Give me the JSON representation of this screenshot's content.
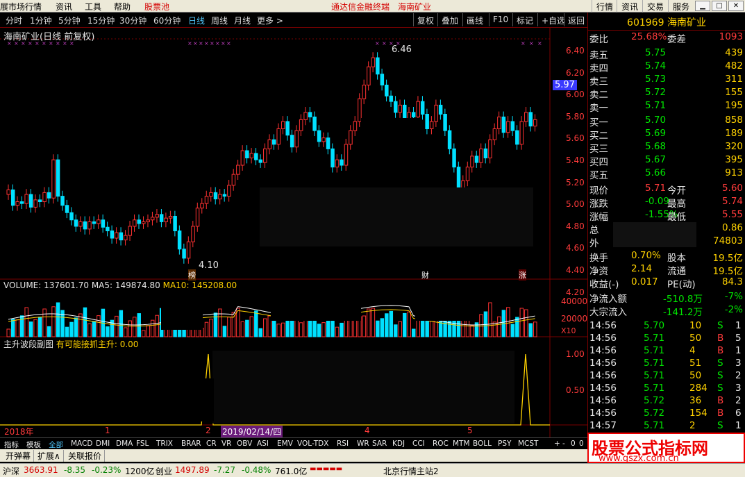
{
  "menubar": {
    "items": [
      "展市场行情",
      "资讯",
      "工具",
      "帮助",
      "股票池"
    ],
    "center": [
      "通达信金融终端",
      "海南矿业"
    ],
    "right": [
      "行情",
      "资讯",
      "交易",
      "服务"
    ]
  },
  "toolbar": {
    "periods": [
      "分时",
      "1分钟",
      "5分钟",
      "15分钟",
      "30分钟",
      "60分钟",
      "日线",
      "周线",
      "月线",
      "更多 >"
    ],
    "active": "日线",
    "buttons": [
      "复权",
      "叠加",
      "画线",
      "F10",
      "标记",
      "+自选",
      "返回"
    ]
  },
  "chart": {
    "title": "海南矿业(日线 前复权)",
    "price_tag": "5.97",
    "high_label": "6.46",
    "low_label": "4.10",
    "markers": [
      "榜",
      "财",
      "涨"
    ],
    "y_ticks": [
      "6.40",
      "6.20",
      "6.00",
      "5.80",
      "5.60",
      "5.40",
      "5.20",
      "5.00",
      "4.80",
      "4.60",
      "4.40",
      "4.20"
    ],
    "volume_header": {
      "vol": "VOLUME: 137601.70",
      "ma5": "MA5: 149874.80",
      "ma10": "MA10: 145208.00"
    },
    "vol_ticks": [
      "40000",
      "20000",
      "X10"
    ],
    "ind_header": {
      "name": "主升波段副图",
      "text": "有可能接抓主升: 0.00"
    },
    "ind_ticks": [
      "1.00",
      "0.50"
    ],
    "date_axis": {
      "year": "2018年",
      "labels": [
        "1",
        "2",
        "4",
        "5"
      ],
      "cursor_date": "2019/02/14/四"
    }
  },
  "chart_data": {
    "type": "candlestick",
    "high": 6.46,
    "low": 4.1,
    "last": 5.97,
    "vol": 137601.7,
    "ma5": 149874.8,
    "ma10": 145208.0,
    "ylim": [
      4.1,
      6.5
    ],
    "closes": [
      4.95,
      4.78,
      4.82,
      4.8,
      4.9,
      4.76,
      4.84,
      4.82,
      4.92,
      4.86,
      5.28,
      4.88,
      4.78,
      4.7,
      4.62,
      4.55,
      4.6,
      4.52,
      4.6,
      4.58,
      4.62,
      4.54,
      4.5,
      4.42,
      4.48,
      4.4,
      4.45,
      4.55,
      4.62,
      4.58,
      4.6,
      4.62,
      4.65,
      4.68,
      4.6,
      4.64,
      4.66,
      4.5,
      4.3,
      4.2,
      4.38,
      4.55,
      4.75,
      4.8,
      4.88,
      4.92,
      4.85,
      4.9,
      4.88,
      5.0,
      5.12,
      5.22,
      5.38,
      5.3,
      5.35,
      5.28,
      5.25,
      5.4,
      5.5,
      5.45,
      5.62,
      5.7,
      5.55,
      5.42,
      5.6,
      5.72,
      5.8,
      5.75,
      5.6,
      5.48,
      5.52,
      5.4,
      5.2,
      5.28,
      5.22,
      5.45,
      5.6,
      5.7,
      5.95,
      6.1,
      6.3,
      6.4,
      6.22,
      6.1,
      5.98,
      5.92,
      5.8,
      5.88,
      5.72,
      5.8,
      5.75,
      5.92,
      5.78,
      5.62,
      5.7,
      5.88,
      5.78,
      5.6,
      5.4,
      5.2,
      4.9,
      5.05,
      5.2,
      5.32,
      5.25,
      5.4,
      5.3,
      5.5,
      5.62,
      5.75,
      5.58,
      5.7,
      5.6,
      5.45,
      5.7,
      5.8,
      5.65,
      5.72
    ]
  },
  "book": {
    "code": "601969",
    "name": "海南矿业",
    "weibi": {
      "l": "委比",
      "v": "25.68%",
      "l2": "委差",
      "v2": "1093"
    },
    "sell": [
      {
        "l": "卖五",
        "p": "5.75",
        "q": "439"
      },
      {
        "l": "卖四",
        "p": "5.74",
        "q": "482"
      },
      {
        "l": "卖三",
        "p": "5.73",
        "q": "311"
      },
      {
        "l": "卖二",
        "p": "5.72",
        "q": "155"
      },
      {
        "l": "卖一",
        "p": "5.71",
        "q": "195"
      }
    ],
    "buy": [
      {
        "l": "买一",
        "p": "5.70",
        "q": "858"
      },
      {
        "l": "买二",
        "p": "5.69",
        "q": "189"
      },
      {
        "l": "买三",
        "p": "5.68",
        "q": "320"
      },
      {
        "l": "买四",
        "p": "5.67",
        "q": "395"
      },
      {
        "l": "买五",
        "p": "5.66",
        "q": "913"
      }
    ],
    "stats": [
      {
        "l": "现价",
        "v": "5.71",
        "l2": "今开",
        "v2": "5.60"
      },
      {
        "l": "涨跌",
        "v": "-0.09",
        "l2": "最高",
        "v2": "5.74"
      },
      {
        "l": "涨幅",
        "v": "-1.55%",
        "l2": "最低",
        "v2": "5.55"
      },
      {
        "l": "总",
        "v": "",
        "l2": "",
        "v2": "0.86"
      },
      {
        "l": "外",
        "v": "",
        "l2": "",
        "v2": "74803"
      }
    ],
    "stats2": [
      {
        "l": "换手",
        "v": "0.70%",
        "l2": "股本",
        "v2": "19.5亿"
      },
      {
        "l": "净资",
        "v": "2.14",
        "l2": "流通",
        "v2": "19.5亿"
      },
      {
        "l": "收益(-)",
        "v": "0.017",
        "l2": "PE(动)",
        "v2": "84.3"
      }
    ],
    "flow": [
      {
        "l": "净流入额",
        "v": "-510.8万",
        "p": "-7%"
      },
      {
        "l": "大宗流入",
        "v": "-141.2万",
        "p": "-2%"
      }
    ],
    "ticks": [
      {
        "t": "14:56",
        "p": "5.70",
        "q": "10",
        "s": "S",
        "n": "1"
      },
      {
        "t": "14:56",
        "p": "5.71",
        "q": "50",
        "s": "B",
        "n": "5"
      },
      {
        "t": "14:56",
        "p": "5.71",
        "q": "4",
        "s": "B",
        "n": "1"
      },
      {
        "t": "14:56",
        "p": "5.71",
        "q": "51",
        "s": "S",
        "n": "3"
      },
      {
        "t": "14:56",
        "p": "5.71",
        "q": "50",
        "s": "S",
        "n": "2"
      },
      {
        "t": "14:56",
        "p": "5.71",
        "q": "284",
        "s": "S",
        "n": "3"
      },
      {
        "t": "14:56",
        "p": "5.72",
        "q": "36",
        "s": "B",
        "n": "2"
      },
      {
        "t": "14:56",
        "p": "5.72",
        "q": "154",
        "s": "B",
        "n": "6"
      },
      {
        "t": "14:57",
        "p": "5.71",
        "q": "2",
        "s": "S",
        "n": "1"
      }
    ]
  },
  "tabs": [
    "指标",
    "模板",
    "全部",
    "MACD",
    "DMI",
    "DMA",
    "FSL",
    "TRIX",
    "BRAR",
    "CR",
    "VR",
    "OBV",
    "ASI",
    "EMV",
    "VOL-TDX",
    "RSI",
    "WR",
    "SAR",
    "KDJ",
    "CCI",
    "ROC",
    "MTM",
    "BOLL",
    "PSY",
    "MCST"
  ],
  "tabs_right": [
    "+",
    "-",
    "0",
    "0"
  ],
  "bottom": [
    "开弹幕",
    "扩展∧",
    "关联报价"
  ],
  "status": {
    "sh_l": "沪深",
    "sh": "3663.91",
    "sh_c": "-8.35",
    "sh_p": "-0.23%",
    "sh_a": "1200亿",
    "cy_l": "创业",
    "cy": "1497.89",
    "cy_c": "-7.27",
    "cy_p": "-0.48%",
    "cy_a": "761.0亿",
    "server": "北京行情主站2"
  },
  "ad": {
    "title": "股票公式指标网",
    "url": "www.gszx.com.cn"
  }
}
